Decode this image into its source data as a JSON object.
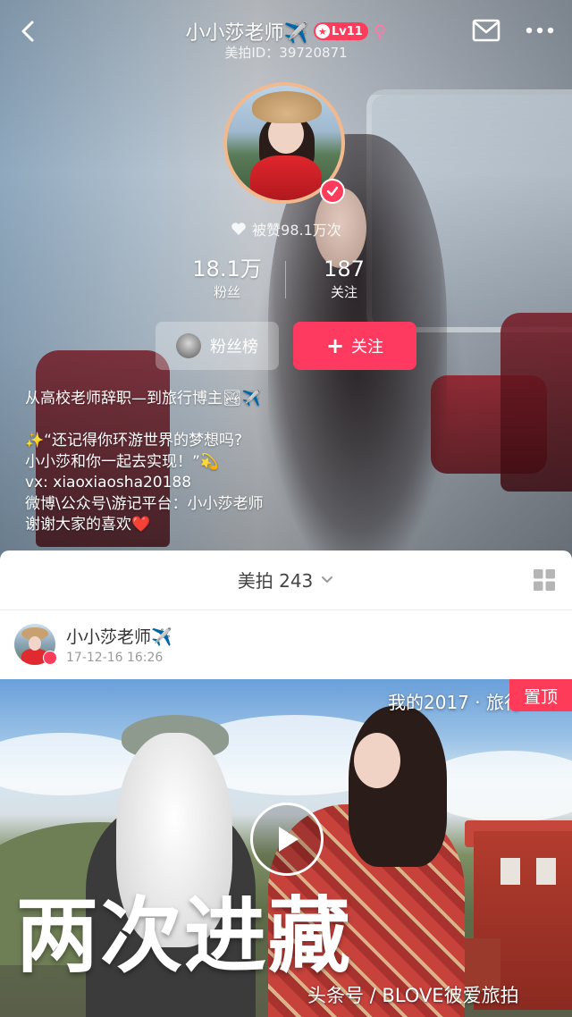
{
  "header": {
    "title": "小小莎老师✈️",
    "level_badge": "Lv11",
    "gender_symbol": "♀",
    "meipai_id": "美拍ID：39720871"
  },
  "profile": {
    "likes_text": "被赞98.1万次",
    "stats": [
      {
        "value": "18.1万",
        "label": "粉丝"
      },
      {
        "value": "187",
        "label": "关注"
      }
    ],
    "fans_rank_label": "粉丝榜",
    "follow_label": "关注",
    "bio_lines": [
      "从高校老师辞职—到旅行博主🏞✈️",
      "",
      "✨“还记得你环游世界的梦想吗?",
      "小小莎和你一起去实现！”💫",
      "vx: xiaoxiaosha20188",
      "微博\\公众号\\游记平台：小小莎老师",
      "谢谢大家的喜欢❤️"
    ]
  },
  "tabs": {
    "current": "美拍 243"
  },
  "post": {
    "author": "小小莎老师✈️",
    "time": "17-12-16 16:26",
    "sticker_text": "我的2017 · 旅行",
    "pinned_label": "置顶",
    "cover_title": "两次进藏"
  },
  "watermark": "头条号 / BLOVE彼爱旅拍",
  "colors": {
    "accent": "#ff3a60",
    "avatar_ring": "#f3b98e"
  },
  "icons": [
    "back-icon",
    "airplane-icon",
    "mail-icon",
    "more-icon",
    "heart-icon",
    "verified-icon",
    "plus-icon",
    "chevron-down-icon",
    "grid-icon",
    "play-icon"
  ]
}
